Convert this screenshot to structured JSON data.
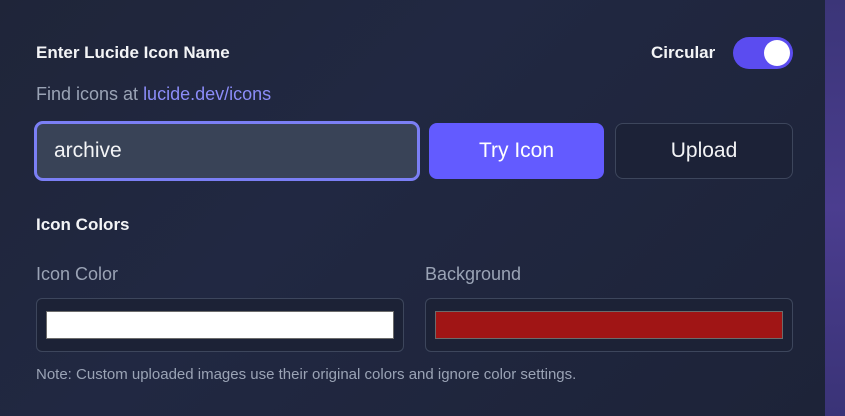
{
  "header": {
    "title": "Enter Lucide Icon Name",
    "circular_label": "Circular",
    "circular_enabled": true
  },
  "help": {
    "prefix": "Find icons at ",
    "link_text": "lucide.dev/icons"
  },
  "input": {
    "value": "archive"
  },
  "buttons": {
    "try_label": "Try Icon",
    "upload_label": "Upload"
  },
  "colors_section": {
    "title": "Icon Colors",
    "icon_color_label": "Icon Color",
    "icon_color_value": "#ffffff",
    "background_label": "Background",
    "background_value": "#a01515"
  },
  "note": "Note: Custom uploaded images use their original colors and ignore color settings.",
  "theme": {
    "accent": "#635bff",
    "focus_border": "#7b7ff5",
    "link": "#8b8cf8"
  }
}
